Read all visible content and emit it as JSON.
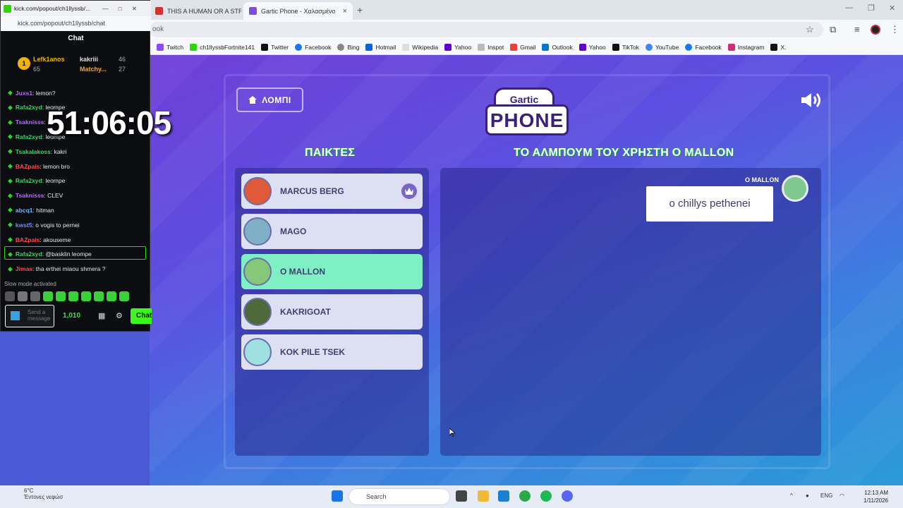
{
  "browser": {
    "tabs": [
      {
        "title": "THIS A HUMAN OR A STREA"
      },
      {
        "title": "Gartic Phone - Χαλασμένο"
      }
    ],
    "new_tab": "+",
    "omnibox_text": "ook",
    "bookmarks": [
      "Twitch",
      "ch1llyssbFortnite141",
      "Twitter",
      "Facebook",
      "Bing",
      "Hotmail",
      "Wikipedia",
      "Yahoo",
      "Inspot",
      "Gmail",
      "Outlook",
      "Yahoo",
      "TikTok",
      "YouTube",
      "Facebook",
      "Instagram",
      "X."
    ]
  },
  "kick": {
    "window_title": "kick.com/popout/ch1llyssb/...",
    "url": "kick.com/popout/ch1llyssb/chat",
    "chat_header": "Chat",
    "leaderboard": [
      {
        "rank": "1",
        "name": "Lefk1anos",
        "score": "65"
      },
      {
        "name": "kakriii",
        "score": "46"
      },
      {
        "name": "Matchy...",
        "score": "27"
      }
    ],
    "messages": [
      {
        "user": "Juxs1",
        "text": ": lemon?",
        "color": "#b36cff"
      },
      {
        "user": "Rafa2xyd",
        "text": ": leompe",
        "color": "#3fd16b"
      },
      {
        "user": "Tsaknisss",
        "text": ": ",
        "color": "#b36cff"
      },
      {
        "user": "Rafa2xyd",
        "text": ": leompe",
        "color": "#3fd16b"
      },
      {
        "user": "Tsakalakoss",
        "text": ": kakri",
        "color": "#3fd16b"
      },
      {
        "user": "BAZpais",
        "text": ": lemon bro",
        "color": "#ff4b4b"
      },
      {
        "user": "Rafa2xyd",
        "text": ": leompe",
        "color": "#3fd16b"
      },
      {
        "user": "Tsaknisss",
        "text": ": CLEV",
        "color": "#b36cff"
      },
      {
        "user": "abcq1",
        "text": ": hitman",
        "color": "#6cb8ff"
      },
      {
        "user": "kwst5",
        "text": ": o vogis to pernei",
        "color": "#6c8cff"
      },
      {
        "user": "BAZpais",
        "text": ": akouseme",
        "color": "#ff4b4b"
      },
      {
        "user": "Rafa2xyd",
        "text": ": @basklin leompe",
        "color": "#3fd16b"
      },
      {
        "user": "Jimas",
        "text": ": tha erthei miaou shmera ?",
        "color": "#ff4b4b"
      }
    ],
    "slow_mode": "Slow mode activated",
    "send_placeholder": "Send a message",
    "points": "1,010",
    "chat_button": "Chat"
  },
  "overlay": {
    "timer": "51:06:05"
  },
  "game": {
    "lobby_button": "ΛΟΜΠΙ",
    "logo_top": "Gartic",
    "logo_bottom": "PHONE",
    "players_heading": "ΠΑΙΚΤΕΣ",
    "album_heading": "ΤΟ ΑΛΜΠΟΥΜ ΤΟΥ ΧΡΗΣΤΗ O MALLON",
    "players": [
      {
        "name": "MARCUS BERG",
        "host": true
      },
      {
        "name": "MAGO"
      },
      {
        "name": "O MALLON",
        "active": true
      },
      {
        "name": "KAKRIGOAT"
      },
      {
        "name": "KOK PILE TSEK"
      }
    ],
    "album_author": "O MALLON",
    "album_entry": "o chillys pethenei"
  },
  "taskbar": {
    "weather_temp": "6°C",
    "weather_desc": "Έντονες νεφώσ",
    "search": "Search",
    "lang": "ENG",
    "time": "12:13 AM",
    "date": "1/11/2026"
  },
  "colors": {
    "accent_green": "#2bd900",
    "active_player": "#7ef0c4",
    "game_bg": "#5b4fe0"
  }
}
